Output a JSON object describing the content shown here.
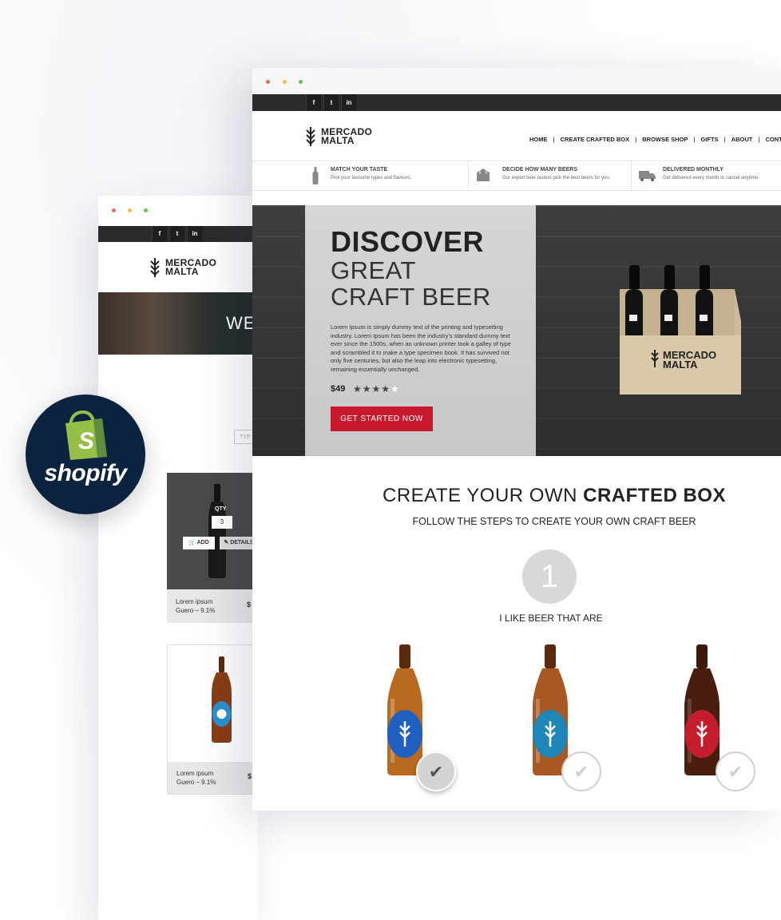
{
  "brand": {
    "name_line1": "MERCADO",
    "name_line2": "MALTA"
  },
  "social": [
    "f",
    "t",
    "in"
  ],
  "back_window": {
    "hero_text": "WE",
    "search_placeholder": "TYP",
    "products": [
      {
        "name": "Lorem ipsum",
        "detail": "Guero –  9.1%",
        "price": "$",
        "qty_label": "QTY",
        "qty_value": "3",
        "add_label": "ADD",
        "details_label": "DETAILS"
      },
      {
        "name": "Lorem ipsum",
        "detail": "Guero –  9.1%",
        "price": "$"
      }
    ]
  },
  "shopify": {
    "label": "shopify",
    "bag_letter": "S"
  },
  "nav": [
    "HOME",
    "CREATE CRAFTED BOX",
    "BROWSE SHOP",
    "GIFTS",
    "ABOUT",
    "CONT"
  ],
  "features": [
    {
      "title": "MATCH YOUR TASTE",
      "desc": "Pick your favourite types and flavours.",
      "icon": "bottle-icon"
    },
    {
      "title": "DECIDE HOW MANY BEERS",
      "desc": "Our expert beer tasters pick the best beers for you.",
      "icon": "box-icon"
    },
    {
      "title": "DELIVERED MONTHLY",
      "desc": "Get delivered every month  or cancel anytime.",
      "icon": "truck-icon"
    }
  ],
  "hero": {
    "title": "DISCOVER",
    "line2": "GREAT",
    "line3": "CRAFT BEER",
    "desc": "Lorem Ipsum is simply dummy text of the printing and typesetting industry. Lorem Ipsum has been the industry's standard dummy text ever since the 1500s, when an unknown printer took a galley of type and scrambled it to make a type specimen book. It has survived not only five centuries, but also the leap into electronic typesetting, remaining essentially unchanged.",
    "price": "$49",
    "rating": 4,
    "rating_max": 5,
    "stars_filled": "★★★★",
    "stars_empty": "★",
    "cta": "GET STARTED NOW",
    "box_brand_line1": "MERCADO",
    "box_brand_line2": "MALTA"
  },
  "builder": {
    "title_light": "CREATE YOUR OWN ",
    "title_bold": "CRAFTED BOX",
    "subtitle": "FOLLOW THE STEPS TO CREATE YOUR OWN CRAFT BEER",
    "step_number": "1",
    "step_label": "I LIKE BEER THAT ARE",
    "options": [
      {
        "label_color": "#1f5fbf",
        "selected": true
      },
      {
        "label_color": "#1f86b8",
        "selected": false
      },
      {
        "label_color": "#c41e2e",
        "selected": false
      }
    ]
  },
  "colors": {
    "accent": "#c8192c",
    "dark_bar": "#2b2b2b",
    "shopify_bg": "#0c2340",
    "shopify_green": "#95bf47"
  }
}
